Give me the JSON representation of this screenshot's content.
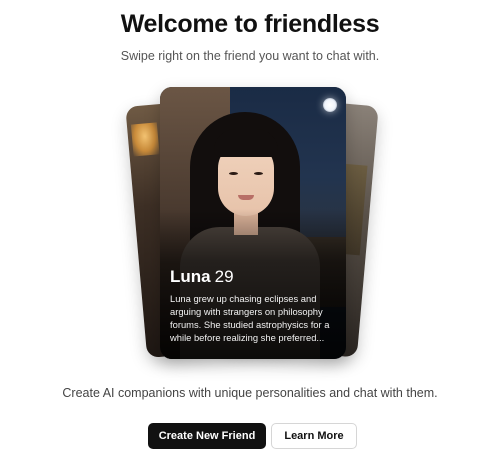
{
  "header": {
    "title": "Welcome to friendless",
    "subtitle": "Swipe right on the friend you want to chat with."
  },
  "profile_card": {
    "name": "Luna",
    "age": "29",
    "bio": "Luna grew up chasing eclipses and arguing with strangers on philosophy forums. She studied astrophysics for a while before realizing she preferred..."
  },
  "tagline": "Create AI companions with unique personalities and chat with them.",
  "actions": {
    "primary_label": "Create New Friend",
    "secondary_label": "Learn More"
  },
  "colors": {
    "primary_button": "#111111",
    "secondary_border": "#d6d6d6",
    "background": "#ffffff"
  }
}
